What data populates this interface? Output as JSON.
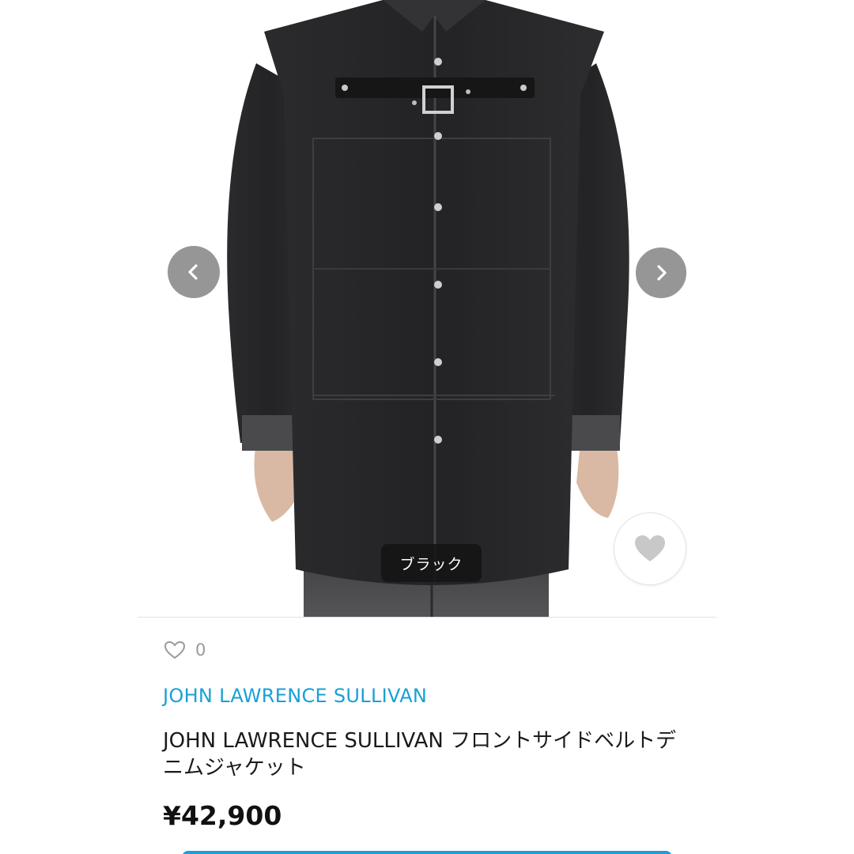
{
  "gallery": {
    "variant_label": "ブラック",
    "prev_icon": "chevron-left-icon",
    "next_icon": "chevron-right-icon",
    "favorite_icon": "heart-icon"
  },
  "product": {
    "like_count": "0",
    "brand": "JOHN LAWRENCE SULLIVAN",
    "title": "JOHN LAWRENCE SULLIVAN フロントサイドベルトデニムジャケット",
    "price": "¥42,900"
  },
  "colors": {
    "brand": "#1a9fd8",
    "text": "#1a1a1a",
    "muted": "#999999"
  }
}
